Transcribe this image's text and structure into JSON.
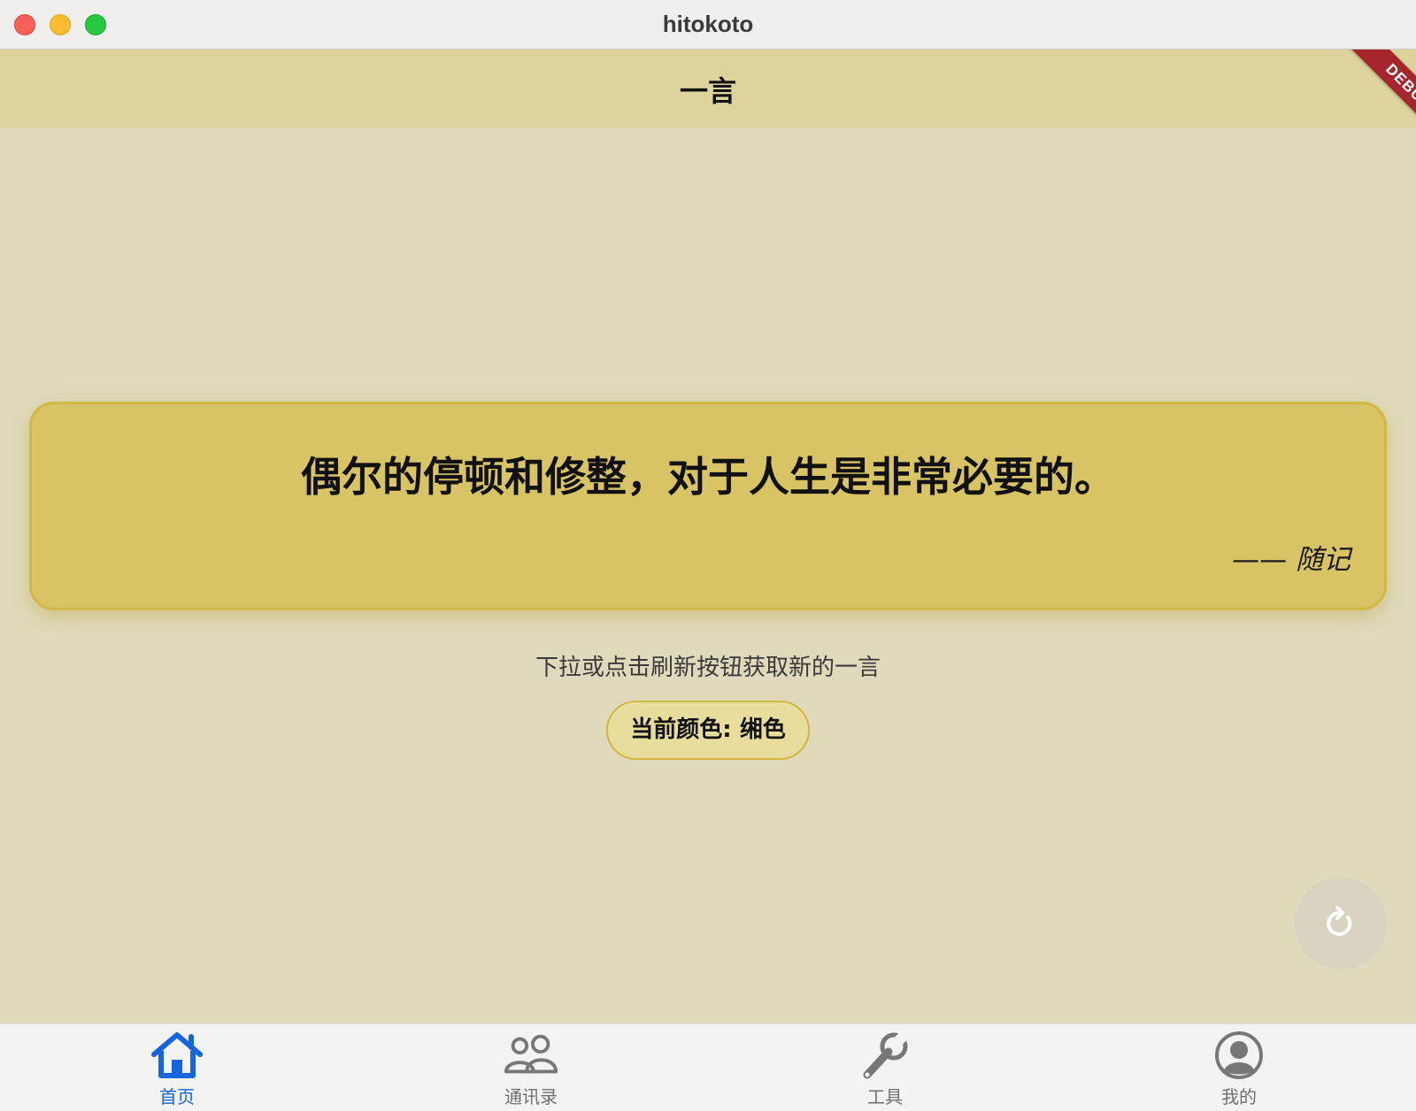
{
  "window": {
    "title": "hitokoto"
  },
  "appbar": {
    "title": "一言",
    "debug_banner": "DEBUG"
  },
  "quote": {
    "text": "偶尔的停顿和修整，对于人生是非常必要的。",
    "source": "—— 随记"
  },
  "hint": "下拉或点击刷新按钮获取新的一言",
  "color_chip": {
    "label": "当前颜色: 缃色"
  },
  "fab": {
    "icon": "refresh-icon"
  },
  "bottom_nav": {
    "items": [
      {
        "label": "首页",
        "icon": "home-icon",
        "active": true
      },
      {
        "label": "通讯录",
        "icon": "contacts-icon",
        "active": false
      },
      {
        "label": "工具",
        "icon": "wrench-icon",
        "active": false
      },
      {
        "label": "我的",
        "icon": "profile-icon",
        "active": false
      }
    ]
  },
  "colors": {
    "background": "#dfdabb",
    "appbar": "#dcd39d",
    "card": "#d8c465",
    "card_border": "#d3b743",
    "active_nav": "#1565e0",
    "inactive_nav": "#6f6f6f",
    "debug": "#a5262c"
  }
}
